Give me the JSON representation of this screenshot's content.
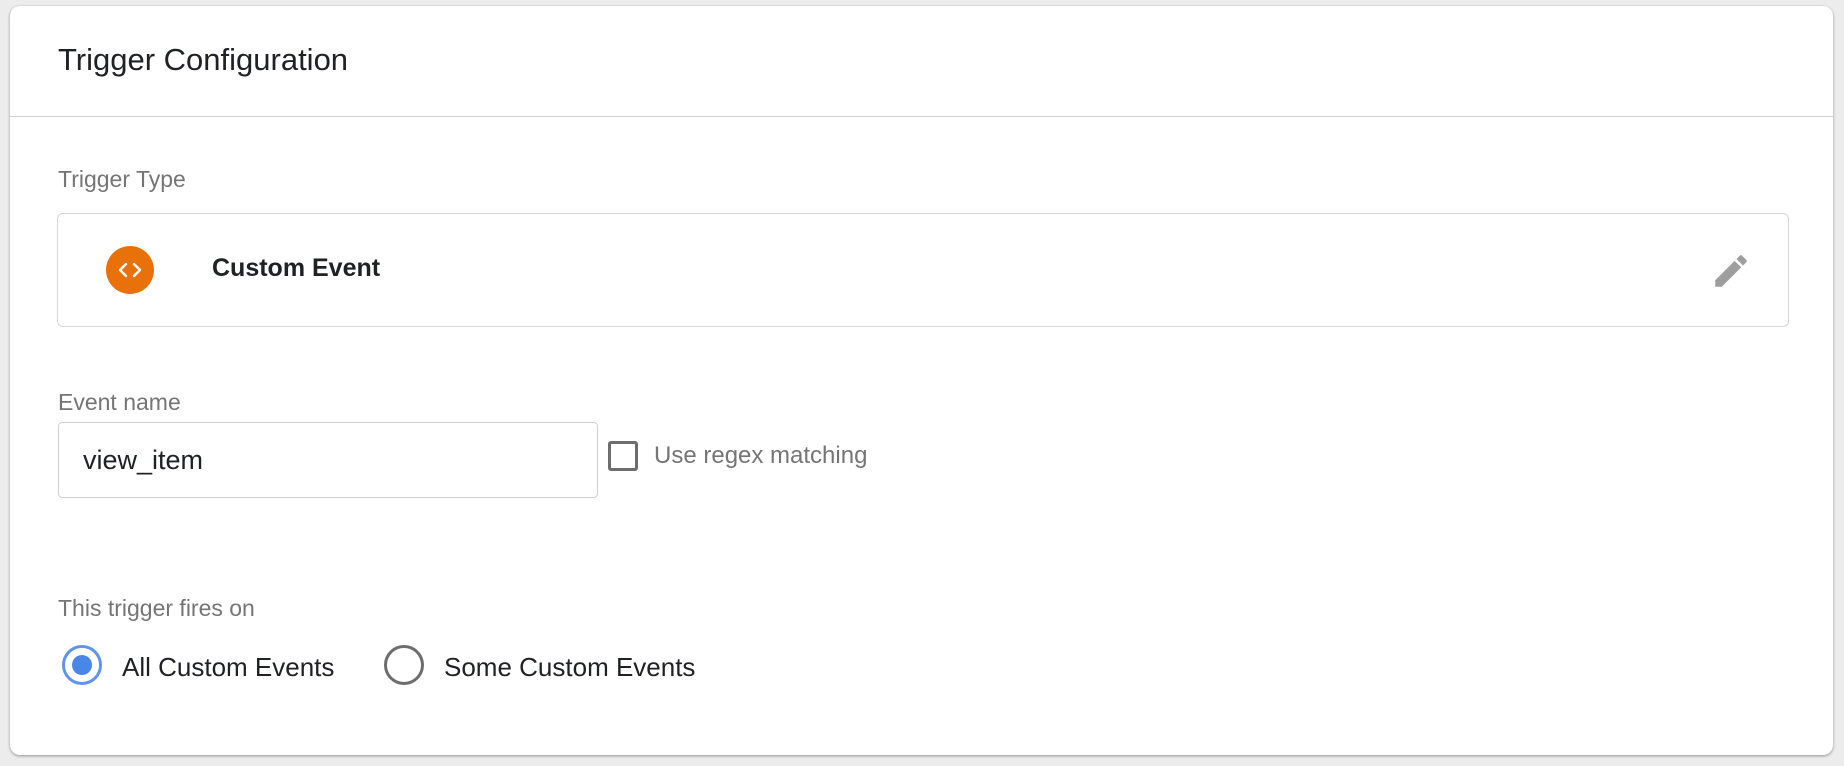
{
  "card": {
    "title": "Trigger Configuration"
  },
  "trigger_type": {
    "label": "Trigger Type",
    "selected": "Custom Event",
    "icon": "code-brackets-icon",
    "icon_color": "#e8710a"
  },
  "event_name": {
    "label": "Event name",
    "value": "view_item",
    "regex_label": "Use regex matching",
    "regex_checked": false
  },
  "fires_on": {
    "label": "This trigger fires on",
    "options": [
      {
        "label": "All Custom Events",
        "selected": true
      },
      {
        "label": "Some Custom Events",
        "selected": false
      }
    ],
    "accent_color": "#4a86e8"
  }
}
